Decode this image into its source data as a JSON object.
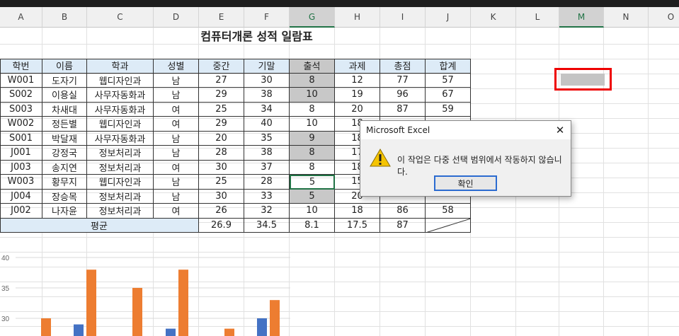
{
  "columns": [
    "A",
    "B",
    "C",
    "D",
    "E",
    "F",
    "G",
    "H",
    "I",
    "J",
    "K",
    "L",
    "M",
    "N",
    "O"
  ],
  "title": "컴퓨터개론 성적 일람표",
  "table": {
    "headers": [
      "학번",
      "이름",
      "학과",
      "성별",
      "중간",
      "기말",
      "출석",
      "과제",
      "총점",
      "합계"
    ],
    "rows": [
      [
        "W001",
        "도자기",
        "웹디자인과",
        "남",
        "27",
        "30",
        "8",
        "12",
        "77",
        "57"
      ],
      [
        "S002",
        "이용실",
        "사무자동화과",
        "남",
        "29",
        "38",
        "10",
        "19",
        "96",
        "67"
      ],
      [
        "S003",
        "차새대",
        "사무자동화과",
        "여",
        "25",
        "34",
        "8",
        "20",
        "87",
        "59"
      ],
      [
        "W002",
        "정든별",
        "웹디자인과",
        "여",
        "29",
        "40",
        "10",
        "18",
        "",
        ""
      ],
      [
        "S001",
        "박달재",
        "사무자동화과",
        "남",
        "20",
        "35",
        "9",
        "18",
        "",
        ""
      ],
      [
        "J001",
        "강정국",
        "정보처리과",
        "남",
        "28",
        "38",
        "8",
        "17",
        "",
        ""
      ],
      [
        "J003",
        "송지연",
        "정보처리과",
        "여",
        "30",
        "37",
        "8",
        "18",
        "",
        ""
      ],
      [
        "W003",
        "황무지",
        "웹디자인과",
        "남",
        "25",
        "28",
        "5",
        "15",
        "",
        ""
      ],
      [
        "J004",
        "장승목",
        "정보처리과",
        "남",
        "30",
        "33",
        "5",
        "20",
        "",
        ""
      ],
      [
        "J002",
        "나자윤",
        "정보처리과",
        "여",
        "26",
        "32",
        "10",
        "18",
        "86",
        "58"
      ]
    ],
    "avg_label": "평균",
    "avg_values": [
      "26.9",
      "34.5",
      "8.1",
      "17.5",
      "87"
    ]
  },
  "chart_data": {
    "type": "bar",
    "y_ticks": [
      "40",
      "35",
      "30"
    ],
    "ylim": [
      28,
      40
    ],
    "series": [
      {
        "color": "#4472c4",
        "values": [
          null,
          29,
          null,
          28.3,
          null,
          30
        ]
      },
      {
        "color": "#ed7d31",
        "values": [
          30,
          38,
          35,
          38,
          28.3,
          33
        ]
      }
    ]
  },
  "dialog": {
    "title": "Microsoft Excel",
    "close_label": "✕",
    "message": "이 작업은 다중 선택 범위에서 작동하지 않습니다.",
    "ok_label": "확인",
    "icon": "warning-icon"
  }
}
